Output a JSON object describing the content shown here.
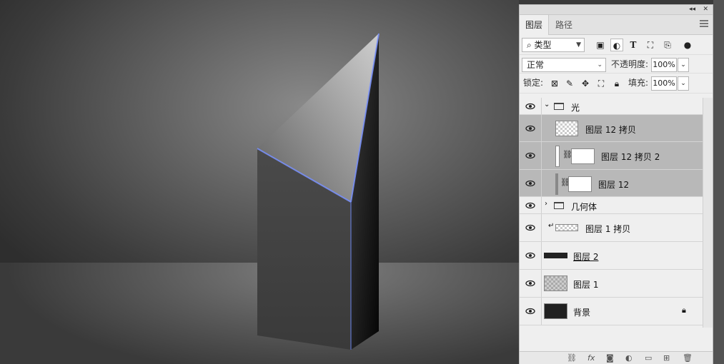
{
  "panel": {
    "collapse_icon": "◂◂",
    "close_icon": "✕",
    "tabs": [
      {
        "label": "图层"
      },
      {
        "label": "路径"
      }
    ],
    "filter": {
      "label": "类型",
      "icon": "search-icon"
    },
    "blend_mode": "正常",
    "opacity_label": "不透明度:",
    "opacity_value": "100%",
    "lock_label": "锁定:",
    "fill_label": "填充:",
    "fill_value": "100%",
    "type_filter_T": "T"
  },
  "layers": [
    {
      "name": "光",
      "kind": "group",
      "expanded": true,
      "selected": false
    },
    {
      "name": "图层 12 拷贝",
      "kind": "layer",
      "selected": true
    },
    {
      "name": "图层 12 拷贝 2",
      "kind": "masked",
      "selected": true
    },
    {
      "name": "图层 12",
      "kind": "masked",
      "selected": true
    },
    {
      "name": "几何体",
      "kind": "group",
      "expanded": false,
      "selected": false
    },
    {
      "name": "图层 1 拷贝",
      "kind": "clipped",
      "selected": false
    },
    {
      "name": "图层 2",
      "kind": "dark",
      "selected": false
    },
    {
      "name": "图层 1",
      "kind": "checker",
      "selected": false
    },
    {
      "name": "背景",
      "kind": "background",
      "selected": false
    }
  ],
  "bottom_icons": [
    "link-icon",
    "fx-icon",
    "mask-icon",
    "adjustment-icon",
    "folder-icon",
    "new-layer-icon",
    "trash-icon"
  ],
  "colors": {
    "accent_edge": "#6f8cff",
    "selected_row": "#b8b8b8",
    "panel_bg": "#efefef"
  }
}
